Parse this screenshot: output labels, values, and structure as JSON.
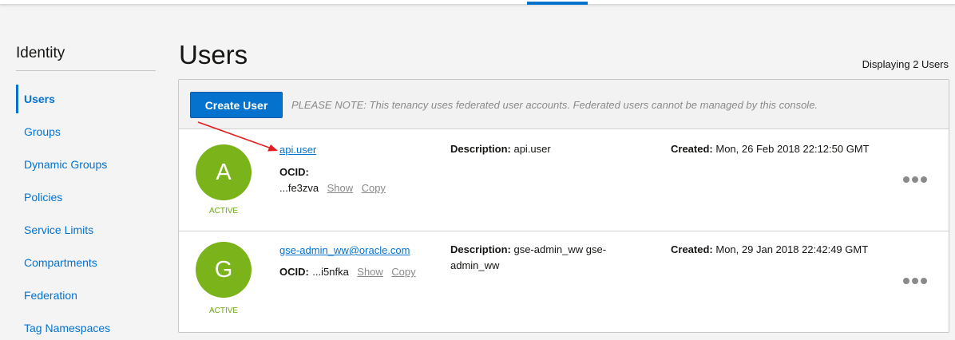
{
  "topbar": {
    "accent": "#0572ce"
  },
  "sidebar": {
    "title": "Identity",
    "items": [
      {
        "label": "Users",
        "active": true
      },
      {
        "label": "Groups"
      },
      {
        "label": "Dynamic Groups"
      },
      {
        "label": "Policies"
      },
      {
        "label": "Service Limits"
      },
      {
        "label": "Compartments"
      },
      {
        "label": "Federation"
      },
      {
        "label": "Tag Namespaces"
      }
    ]
  },
  "main": {
    "title": "Users",
    "display_count": "Displaying 2 Users",
    "create_button": "Create User",
    "note": "PLEASE NOTE: This tenancy uses federated user accounts. Federated users cannot be managed by this console.",
    "users": [
      {
        "initial": "A",
        "status": "ACTIVE",
        "name": "api.user",
        "ocid_label": "OCID:",
        "ocid_value": "...fe3zva",
        "show_label": "Show",
        "copy_label": "Copy",
        "description_label": "Description:",
        "description": "api.user",
        "created_label": "Created:",
        "created": "Mon, 26 Feb 2018 22:12:50 GMT",
        "menu_icon": "ellipsis-icon"
      },
      {
        "initial": "G",
        "status": "ACTIVE",
        "name": "gse-admin_ww@oracle.com",
        "ocid_label": "OCID:",
        "ocid_value": "...i5nfka",
        "show_label": "Show",
        "copy_label": "Copy",
        "description_label": "Description:",
        "description": "gse-admin_ww gse-admin_ww",
        "created_label": "Created:",
        "created": "Mon, 29 Jan 2018 22:42:49 GMT",
        "menu_icon": "ellipsis-icon"
      }
    ]
  },
  "colors": {
    "link": "#0572ce",
    "avatar": "#7bb31a",
    "status": "#6ea814",
    "annotation_arrow": "#e02020"
  }
}
